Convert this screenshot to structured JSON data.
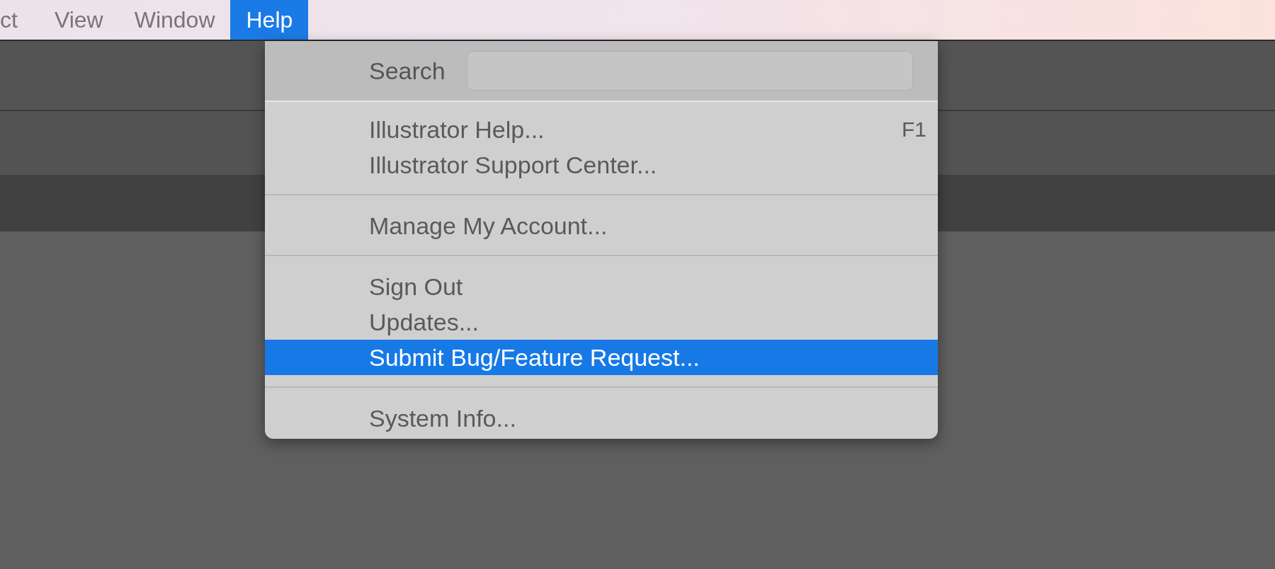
{
  "menu_bar": [
    {
      "label": "ct",
      "selected": false
    },
    {
      "label": "View",
      "selected": false
    },
    {
      "label": "Window",
      "selected": false
    },
    {
      "label": "Help",
      "selected": true
    }
  ],
  "help_menu": {
    "search": {
      "label": "Search"
    },
    "items": [
      {
        "kind": "item",
        "label": "Illustrator Help...",
        "shortcut": "F1",
        "selected": false
      },
      {
        "kind": "item",
        "label": "Illustrator Support Center...",
        "selected": false
      },
      {
        "kind": "separator"
      },
      {
        "kind": "item",
        "label": "Manage My Account...",
        "selected": false
      },
      {
        "kind": "separator"
      },
      {
        "kind": "item",
        "label": "Sign Out",
        "selected": false
      },
      {
        "kind": "item",
        "label": "Updates...",
        "selected": false
      },
      {
        "kind": "item",
        "label": "Submit Bug/Feature Request...",
        "selected": true
      },
      {
        "kind": "separator"
      },
      {
        "kind": "item",
        "label": "System Info...",
        "selected": false
      }
    ]
  }
}
